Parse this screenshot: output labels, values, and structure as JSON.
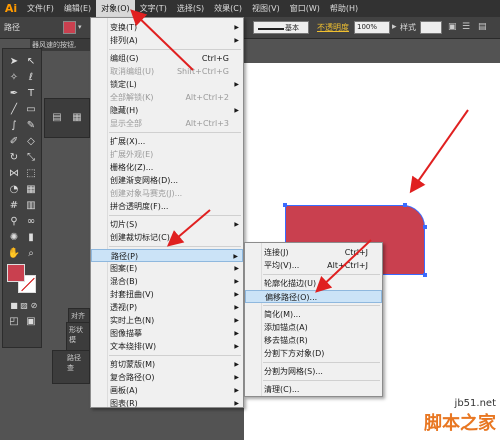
{
  "menubar": {
    "logo": "Ai",
    "items": [
      "文件(F)",
      "编辑(E)",
      "对象(O)",
      "文字(T)",
      "选择(S)",
      "效果(C)",
      "视图(V)",
      "窗口(W)",
      "帮助(H)"
    ]
  },
  "controlbar": {
    "path_label": "路径",
    "stroke_label": "描边:",
    "stroke_style": "基本",
    "opacity_link": "不透明度",
    "opacity_value": "100%",
    "style_label": "样式",
    "fill_color": "#c9404f"
  },
  "doc_tab": "器风速的按钮,",
  "panels": {
    "align_tab": "对齐",
    "shape_tab": "形状模",
    "pathfinder_tab": "路径查"
  },
  "object_menu": {
    "items": [
      {
        "label": "变换(T)",
        "shortcut": "",
        "submenu": true,
        "disabled": false
      },
      {
        "label": "排列(A)",
        "shortcut": "",
        "submenu": true,
        "disabled": false
      },
      {
        "sep": true
      },
      {
        "label": "编组(G)",
        "shortcut": "Ctrl+G",
        "submenu": false,
        "disabled": false
      },
      {
        "label": "取消编组(U)",
        "shortcut": "Shift+Ctrl+G",
        "submenu": false,
        "disabled": true
      },
      {
        "label": "锁定(L)",
        "shortcut": "",
        "submenu": true,
        "disabled": false
      },
      {
        "label": "全部解锁(K)",
        "shortcut": "Alt+Ctrl+2",
        "submenu": false,
        "disabled": true
      },
      {
        "label": "隐藏(H)",
        "shortcut": "",
        "submenu": true,
        "disabled": false
      },
      {
        "label": "显示全部",
        "shortcut": "Alt+Ctrl+3",
        "submenu": false,
        "disabled": true
      },
      {
        "sep": true
      },
      {
        "label": "扩展(X)...",
        "shortcut": "",
        "submenu": false,
        "disabled": false
      },
      {
        "label": "扩展外观(E)",
        "shortcut": "",
        "submenu": false,
        "disabled": true
      },
      {
        "label": "栅格化(Z)...",
        "shortcut": "",
        "submenu": false,
        "disabled": false
      },
      {
        "label": "创建渐变网格(D)...",
        "shortcut": "",
        "submenu": false,
        "disabled": false
      },
      {
        "label": "创建对象马赛克(J)...",
        "shortcut": "",
        "submenu": false,
        "disabled": true
      },
      {
        "label": "拼合透明度(F)...",
        "shortcut": "",
        "submenu": false,
        "disabled": false
      },
      {
        "sep": true
      },
      {
        "label": "切片(S)",
        "shortcut": "",
        "submenu": true,
        "disabled": false
      },
      {
        "label": "创建裁切标记(C)",
        "shortcut": "",
        "submenu": false,
        "disabled": false
      },
      {
        "sep": true
      },
      {
        "label": "路径(P)",
        "shortcut": "",
        "submenu": true,
        "disabled": false,
        "highlight": true
      },
      {
        "label": "图案(E)",
        "shortcut": "",
        "submenu": true,
        "disabled": false
      },
      {
        "label": "混合(B)",
        "shortcut": "",
        "submenu": true,
        "disabled": false
      },
      {
        "label": "封套扭曲(V)",
        "shortcut": "",
        "submenu": true,
        "disabled": false
      },
      {
        "label": "透视(P)",
        "shortcut": "",
        "submenu": true,
        "disabled": false
      },
      {
        "label": "实时上色(N)",
        "shortcut": "",
        "submenu": true,
        "disabled": false
      },
      {
        "label": "图像描摹",
        "shortcut": "",
        "submenu": true,
        "disabled": false
      },
      {
        "label": "文本绕排(W)",
        "shortcut": "",
        "submenu": true,
        "disabled": false
      },
      {
        "sep": true
      },
      {
        "label": "剪切蒙版(M)",
        "shortcut": "",
        "submenu": true,
        "disabled": false
      },
      {
        "label": "复合路径(O)",
        "shortcut": "",
        "submenu": true,
        "disabled": false
      },
      {
        "label": "画板(A)",
        "shortcut": "",
        "submenu": true,
        "disabled": false
      },
      {
        "label": "图表(R)",
        "shortcut": "",
        "submenu": true,
        "disabled": false
      }
    ]
  },
  "path_submenu": {
    "items": [
      {
        "label": "连接(J)",
        "shortcut": "Ctrl+J"
      },
      {
        "label": "平均(V)...",
        "shortcut": "Alt+Ctrl+J"
      },
      {
        "sep": true
      },
      {
        "label": "轮廓化描边(U)",
        "shortcut": ""
      },
      {
        "label": "偏移路径(O)...",
        "shortcut": "",
        "highlight": true
      },
      {
        "sep": true
      },
      {
        "label": "简化(M)...",
        "shortcut": ""
      },
      {
        "label": "添加锚点(A)",
        "shortcut": ""
      },
      {
        "label": "移去锚点(R)",
        "shortcut": ""
      },
      {
        "label": "分割下方对象(D)",
        "shortcut": ""
      },
      {
        "sep": true
      },
      {
        "label": "分割为网格(S)...",
        "shortcut": ""
      },
      {
        "sep": true
      },
      {
        "label": "清理(C)...",
        "shortcut": ""
      }
    ]
  },
  "watermark": {
    "url": "jb51.net",
    "name": "脚本之家"
  }
}
